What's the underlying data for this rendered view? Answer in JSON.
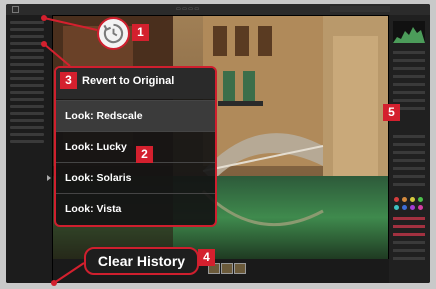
{
  "history_menu": {
    "revert_label": "Revert to Original",
    "items": [
      "Look: Redscale",
      "Look: Lucky",
      "Look: Solaris",
      "Look: Vista"
    ]
  },
  "clear_history_label": "Clear History",
  "callouts": [
    "1",
    "2",
    "3",
    "4",
    "5"
  ],
  "colors": {
    "accent": "#d4202e",
    "panel": "#1c1c1c"
  }
}
